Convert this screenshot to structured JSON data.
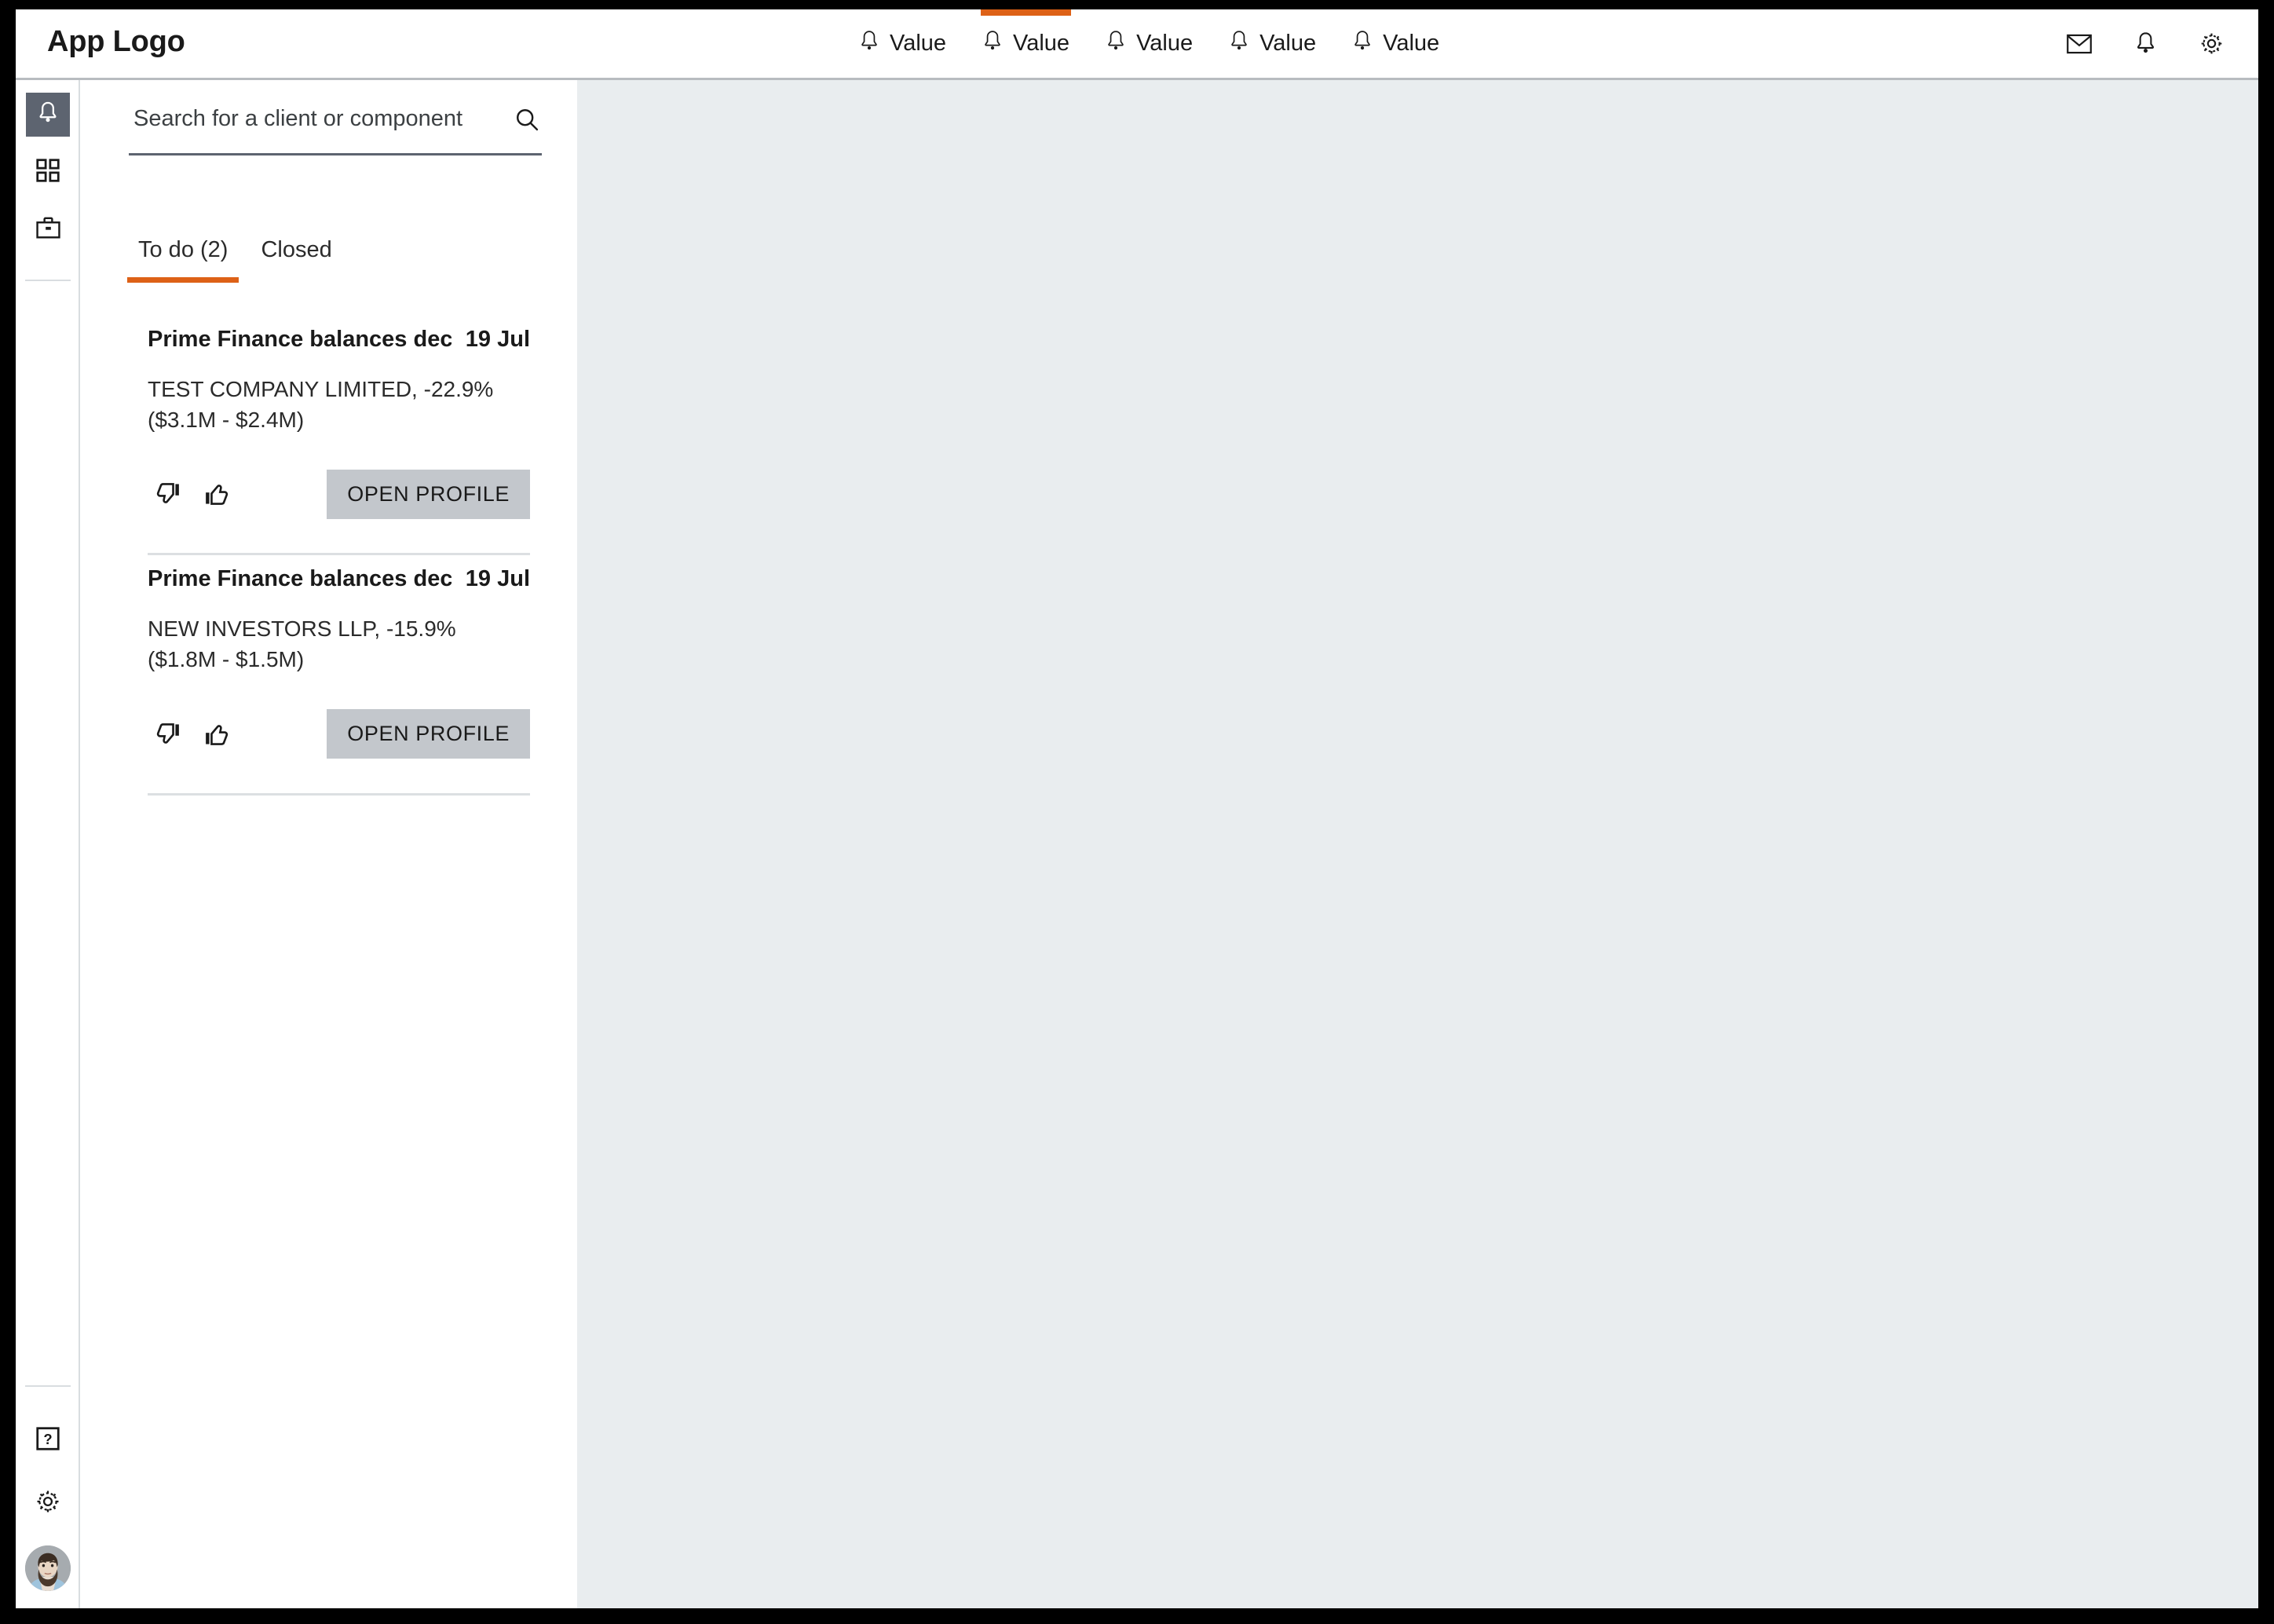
{
  "header": {
    "logo": "App Logo",
    "nav_items": [
      {
        "icon": "bell-icon",
        "label": "Value",
        "active": false
      },
      {
        "icon": "bell-icon",
        "label": "Value",
        "active": true
      },
      {
        "icon": "bell-icon",
        "label": "Value",
        "active": false
      },
      {
        "icon": "bell-icon",
        "label": "Value",
        "active": false
      },
      {
        "icon": "bell-icon",
        "label": "Value",
        "active": false
      }
    ],
    "actions": [
      {
        "icon": "mail-icon",
        "name": "messages-button"
      },
      {
        "icon": "bell-icon",
        "name": "notifications-button"
      },
      {
        "icon": "gear-icon",
        "name": "settings-button"
      }
    ]
  },
  "sidebar": {
    "top_items": [
      {
        "icon": "bell-icon",
        "name": "rail-item-alerts",
        "active": true
      },
      {
        "icon": "grid-icon",
        "name": "rail-item-dashboard",
        "active": false
      },
      {
        "icon": "briefcase-icon",
        "name": "rail-item-portfolio",
        "active": false
      }
    ],
    "bottom_items": [
      {
        "icon": "help-icon",
        "name": "rail-item-help"
      },
      {
        "icon": "gear-icon",
        "name": "rail-item-settings"
      },
      {
        "icon": "avatar-icon",
        "name": "rail-item-profile"
      }
    ]
  },
  "search": {
    "placeholder": "Search for a client or component",
    "value": "",
    "icon": "search-icon"
  },
  "tabs": [
    {
      "label": "To do (2)",
      "active": true
    },
    {
      "label": "Closed",
      "active": false
    }
  ],
  "notifications": [
    {
      "title": "Prime Finance balances declined...",
      "date": "19 Jul",
      "body": "TEST COMPANY LIMITED, -22.9% ($3.1M - $2.4M)",
      "dislike_icon": "thumbs-down-icon",
      "like_icon": "thumbs-up-icon",
      "action_label": "OPEN PROFILE"
    },
    {
      "title": "Prime Finance balances declined...",
      "date": "19 Jul",
      "body": "NEW INVESTORS LLP, -15.9% ($1.8M - $1.5M)",
      "dislike_icon": "thumbs-down-icon",
      "like_icon": "thumbs-up-icon",
      "action_label": "OPEN PROFILE"
    }
  ],
  "colors": {
    "accent_orange": "#dd6117",
    "rail_active_bg": "#5d6470",
    "button_gray": "#c3c7cc",
    "main_bg": "#e9edef"
  }
}
